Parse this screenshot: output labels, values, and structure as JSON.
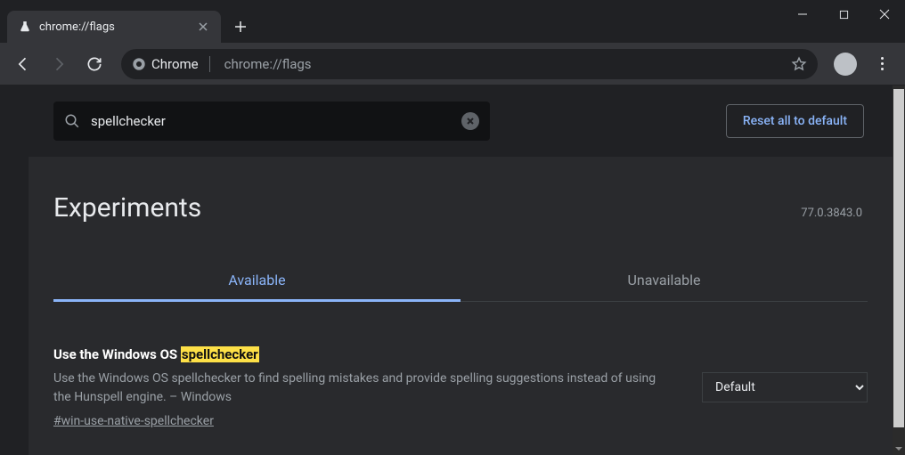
{
  "window": {
    "tab_title": "chrome://flags",
    "url_prefix": "Chrome",
    "url_path": "chrome://flags"
  },
  "top": {
    "search_value": "spellchecker",
    "reset_label": "Reset all to default"
  },
  "heading": {
    "title": "Experiments",
    "version": "77.0.3843.0"
  },
  "tabs": {
    "available": "Available",
    "unavailable": "Unavailable",
    "active": "available"
  },
  "flag": {
    "title_prefix": "Use the Windows OS ",
    "title_highlight": "spellchecker",
    "description": "Use the Windows OS spellchecker to find spelling mistakes and provide spelling suggestions instead of using the Hunspell engine. – Windows",
    "anchor": "#win-use-native-spellchecker",
    "select_value": "Default"
  }
}
